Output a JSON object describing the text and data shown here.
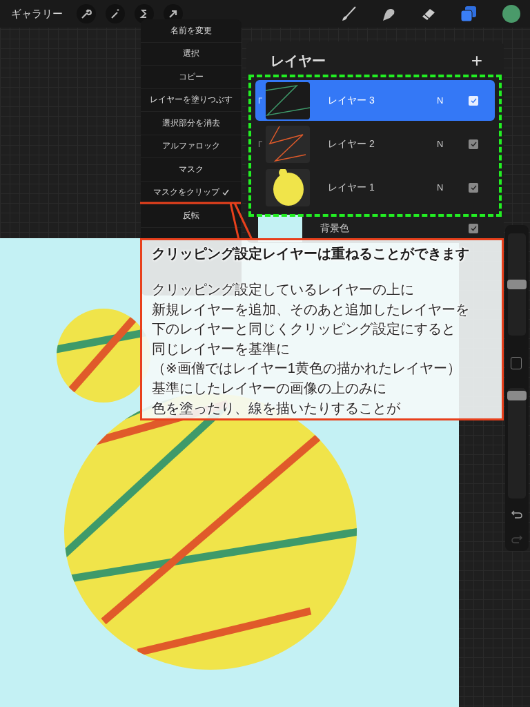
{
  "toolbar": {
    "gallery": "ギャラリー"
  },
  "layer_menu": {
    "items": [
      {
        "label": "名前を変更",
        "checked": false
      },
      {
        "label": "選択",
        "checked": false
      },
      {
        "label": "コピー",
        "checked": false
      },
      {
        "label": "レイヤーを塗りつぶす",
        "checked": false
      },
      {
        "label": "選択部分を消去",
        "checked": false
      },
      {
        "label": "アルファロック",
        "checked": false
      },
      {
        "label": "マスク",
        "checked": false
      },
      {
        "label": "マスクをクリップ",
        "checked": true
      },
      {
        "label": "反転",
        "checked": false
      }
    ]
  },
  "layers_panel": {
    "title": "レイヤー",
    "add_label": "+",
    "layers": [
      {
        "name": "レイヤー 3",
        "blend_mode": "N",
        "selected": true,
        "clipped": true,
        "visible": true,
        "kind": "green-lines"
      },
      {
        "name": "レイヤー 2",
        "blend_mode": "N",
        "selected": false,
        "clipped": true,
        "visible": true,
        "kind": "orange-zigzag"
      },
      {
        "name": "レイヤー 1",
        "blend_mode": "N",
        "selected": false,
        "clipped": false,
        "visible": true,
        "kind": "yellow-blob"
      }
    ],
    "background": {
      "name": "背景色",
      "visible": true
    }
  },
  "side_toolbar": {
    "brush_size": {
      "level": 0.5
    },
    "opacity": {
      "level": 0.97
    }
  },
  "annotation": {
    "title": "クリッピング設定レイヤーは重ねることができます",
    "lines": [
      "クリッピング設定しているレイヤーの上に",
      "新規レイヤーを追加、そのあと追加したレイヤーを",
      "下のレイヤーと同じくクリッピング設定にすると",
      "同じレイヤーを基準に",
      "（※画僧ではレイヤー1黄色の描かれたレイヤー）",
      "基準にしたレイヤーの画像の上のみに",
      "色を塗ったり、線を描いたりすることが"
    ]
  }
}
